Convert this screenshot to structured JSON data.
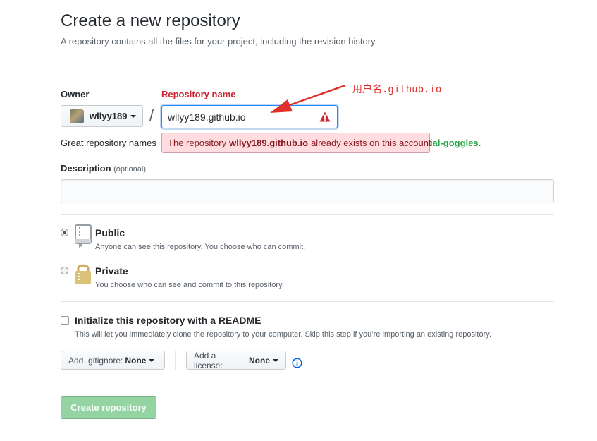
{
  "page": {
    "title": "Create a new repository",
    "subtitle": "A repository contains all the files for your project, including the revision history."
  },
  "owner": {
    "label": "Owner",
    "value": "wllyy189"
  },
  "repo_name": {
    "label": "Repository name",
    "value": "wllyy189.github.io",
    "separator": "/"
  },
  "error": {
    "prefix": "The repository",
    "repo": "wllyy189.github.io",
    "suffix": "already exists on this account"
  },
  "hint": {
    "start": "Great repository names",
    "end": "ial-goggles."
  },
  "description": {
    "label": "Description",
    "optional": "(optional)",
    "value": ""
  },
  "visibility": {
    "public": {
      "title": "Public",
      "note": "Anyone can see this repository. You choose who can commit.",
      "checked": true
    },
    "private": {
      "title": "Private",
      "note": "You choose who can see and commit to this repository.",
      "checked": false
    }
  },
  "readme": {
    "title": "Initialize this repository with a README",
    "note": "This will let you immediately clone the repository to your computer. Skip this step if you’re importing an existing repository.",
    "checked": false
  },
  "gitignore": {
    "label": "Add .gitignore:",
    "value": "None"
  },
  "license": {
    "label": "Add a license:",
    "value": "None"
  },
  "submit": {
    "label": "Create repository"
  },
  "annotation": {
    "text": "用户名.github.io",
    "color": "#e0302b"
  },
  "colors": {
    "error": "#cb2431",
    "focus": "#2188ff",
    "success_disabled": "#94d3a2",
    "link": "#0366d6"
  },
  "icons": [
    "alert-icon",
    "repo-icon",
    "lock-icon",
    "info-icon",
    "caret-down-icon"
  ]
}
